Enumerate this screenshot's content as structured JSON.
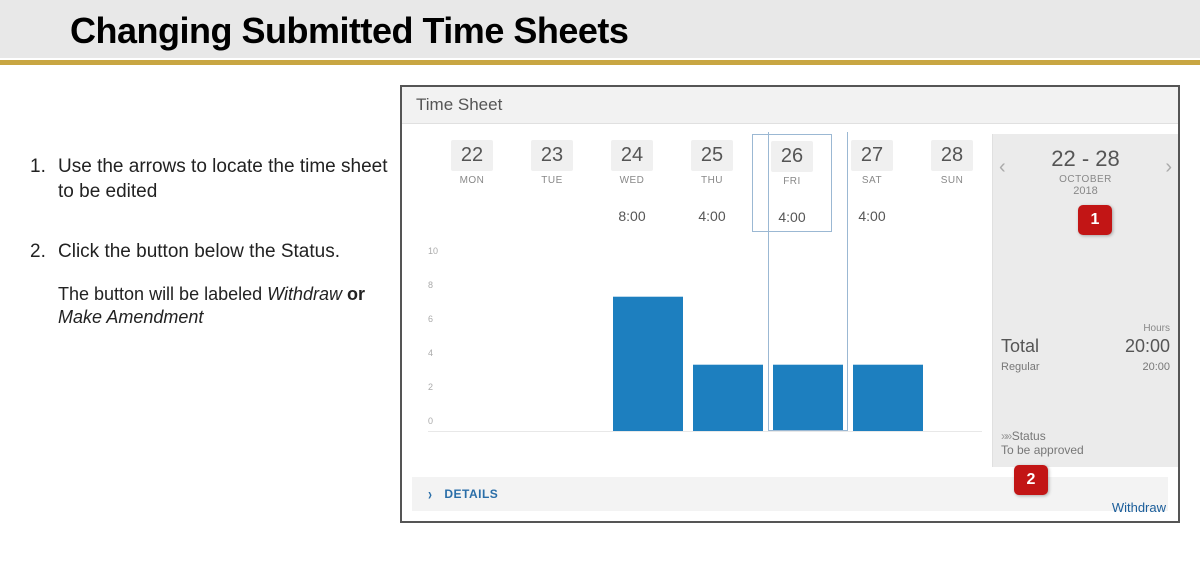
{
  "slide": {
    "title": "Changing Submitted Time Sheets"
  },
  "instructions": {
    "step1_num": "1.",
    "step1_text": "Use the arrows to locate the time sheet to be edited",
    "step2_num": "2.",
    "step2_text": "Click the button below the Status.",
    "step2_sub_pre": "The button will be labeled ",
    "step2_sub_withdraw": "Withdraw",
    "step2_sub_or": " or ",
    "step2_sub_amend": "Make Amendment"
  },
  "timesheet": {
    "panel_title": "Time Sheet",
    "days": [
      {
        "num": "22",
        "abbr": "MON",
        "hours": ""
      },
      {
        "num": "23",
        "abbr": "TUE",
        "hours": ""
      },
      {
        "num": "24",
        "abbr": "WED",
        "hours": "8:00"
      },
      {
        "num": "25",
        "abbr": "THU",
        "hours": "4:00"
      },
      {
        "num": "26",
        "abbr": "FRI",
        "hours": "4:00"
      },
      {
        "num": "27",
        "abbr": "SAT",
        "hours": "4:00"
      },
      {
        "num": "28",
        "abbr": "SUN",
        "hours": ""
      }
    ],
    "selected_index": 4,
    "range": {
      "text": "22 - 28",
      "month": "OCTOBER",
      "year": "2018"
    },
    "totals": {
      "hours_label": "Hours",
      "total_label": "Total",
      "total_value": "20:00",
      "regular_label": "Regular",
      "regular_value": "20:00"
    },
    "status": {
      "label": "Status",
      "value": "To be approved"
    },
    "details_label": "DETAILS",
    "withdraw_label": "Withdraw"
  },
  "callouts": {
    "one": "1",
    "two": "2"
  },
  "chart_data": {
    "type": "bar",
    "title": "Time Sheet Hours",
    "xlabel": "",
    "ylabel": "",
    "ylim": [
      0,
      10
    ],
    "yticks": [
      0,
      2,
      4,
      6,
      8,
      10
    ],
    "categories": [
      "MON 22",
      "TUE 23",
      "WED 24",
      "THU 25",
      "FRI 26",
      "SAT 27",
      "SUN 28"
    ],
    "values": [
      0,
      0,
      8,
      4,
      4,
      4,
      0
    ]
  }
}
